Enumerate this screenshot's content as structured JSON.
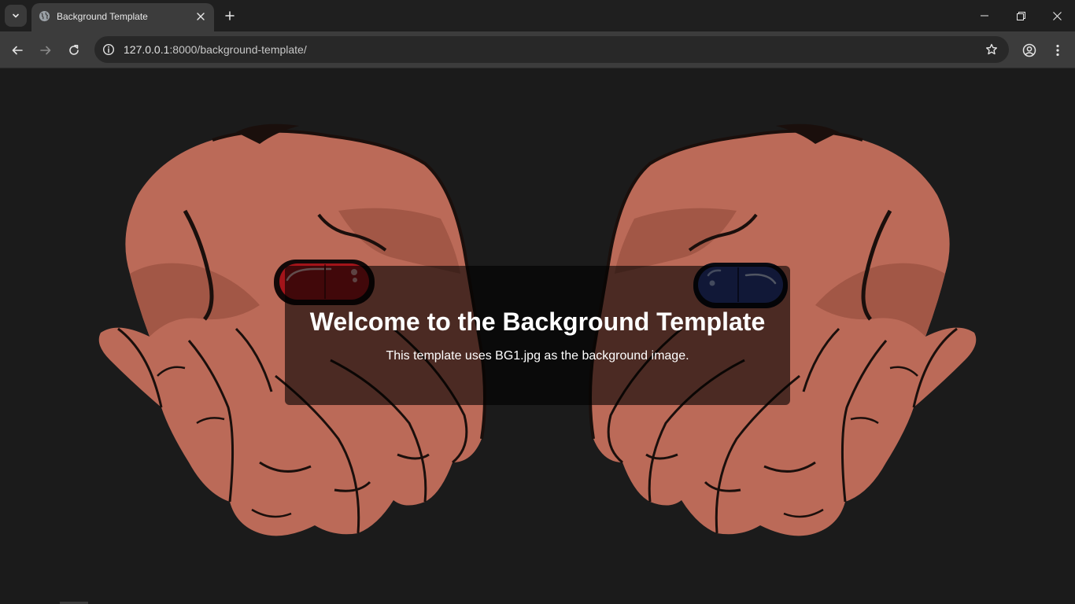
{
  "browser": {
    "tab": {
      "title": "Background Template"
    },
    "address": {
      "host": "127.0.0.1",
      "path": ":8000/background-template/"
    }
  },
  "page": {
    "heading": "Welcome to the Background Template",
    "description": "This template uses BG1.jpg as the background image.",
    "background": {
      "image_icon": "hands-holding-red-and-blue-pills",
      "skin_color": "#bb6a58",
      "red_pill_color": "#a3141a",
      "blue_pill_color": "#2b3d8a"
    }
  },
  "colors": {
    "chrome_dark": "#1f1f1f",
    "chrome_toolbar": "#3c3c3c",
    "page_bg": "#1b1b1b"
  }
}
